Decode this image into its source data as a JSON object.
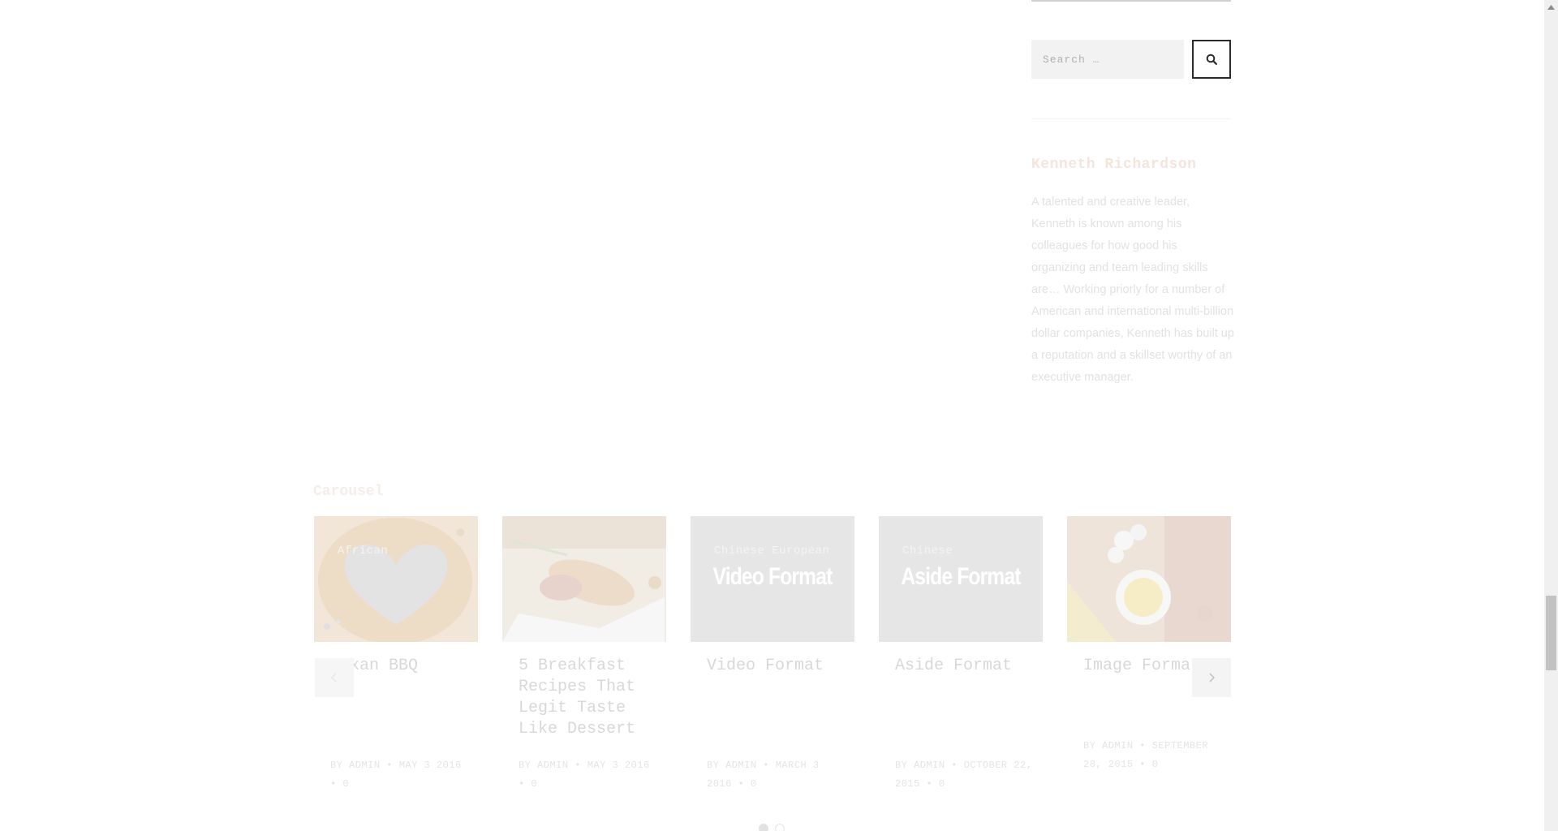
{
  "sidebar": {
    "search": {
      "placeholder": "Search …"
    },
    "author": {
      "name": "Kenneth Richardson",
      "bio": "A talented and creative leader, Kenneth is known among his colleagues for how good his organizing and team leading skills are…  Working priorly for a number of American and international multi-billion dollar companies, Kenneth has built up a reputation and a skillset worthy of an executive manager."
    }
  },
  "carousel": {
    "title": "Carousel",
    "cards": [
      {
        "categories": "African",
        "format_label": "",
        "title": "Texan BBQ",
        "meta": "BY ADMIN • MAY 3 2016 • 0"
      },
      {
        "categories": "",
        "format_label": "",
        "title": "5 Breakfast Recipes That Legit Taste Like Dessert",
        "meta": "BY ADMIN • MAY 3 2016 • 0"
      },
      {
        "categories": "Chinese European",
        "format_label": "Video Format",
        "title": "Video Format",
        "meta": "BY ADMIN • MARCH 3 2016 • 0"
      },
      {
        "categories": "Chinese",
        "format_label": "Aside Format",
        "title": "Aside Format",
        "meta": "BY ADMIN • OCTOBER 22, 2015 • 0"
      },
      {
        "categories": "",
        "format_label": "",
        "title": "Image Format",
        "meta": "BY ADMIN • SEPTEMBER 28, 2015 • 0"
      }
    ],
    "pagination": {
      "pages": 2,
      "active": 1
    }
  },
  "colors": {
    "accent": "#f4e4dc",
    "muted_text": "#e2e2e2",
    "button_border": "#2b2b2b"
  },
  "icons": {
    "search": "search-icon",
    "prev": "chevron-left-icon",
    "next": "chevron-right-icon"
  }
}
